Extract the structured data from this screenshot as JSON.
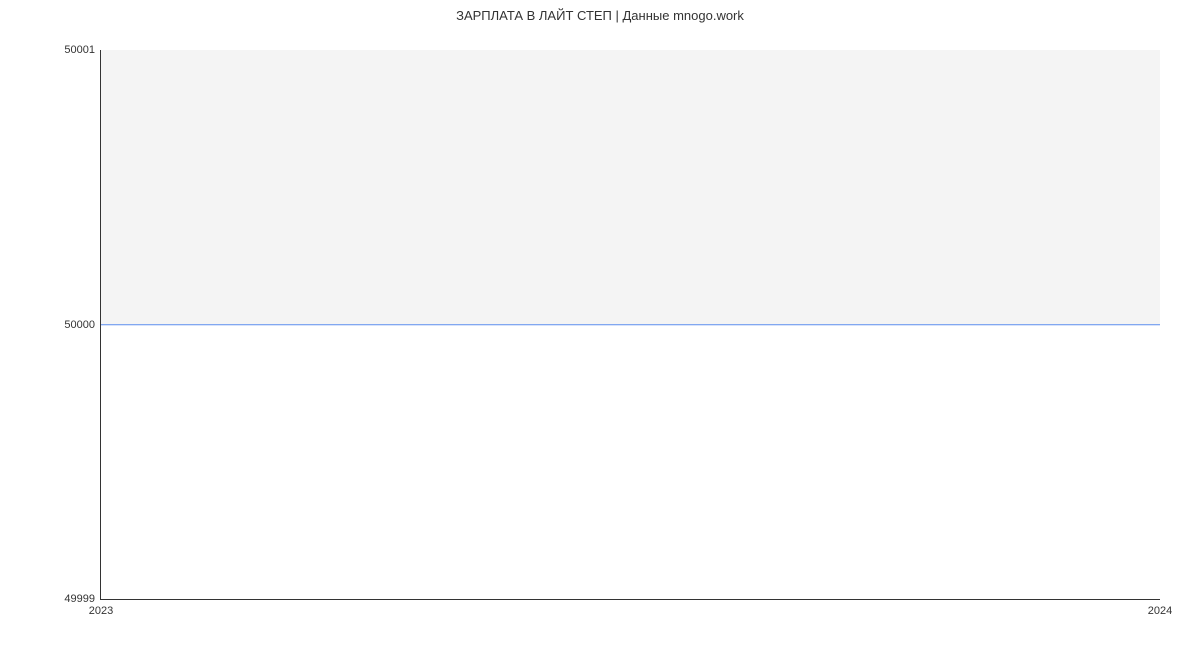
{
  "chart_data": {
    "type": "line",
    "title": "ЗАРПЛАТА В ЛАЙТ СТЕП | Данные mnogo.work",
    "xlabel": "",
    "ylabel": "",
    "x": [
      "2023",
      "2024"
    ],
    "values": [
      50000,
      50000
    ],
    "ylim": [
      49999,
      50001
    ],
    "y_ticks": [
      "49999",
      "50000",
      "50001"
    ],
    "x_ticks": [
      "2023",
      "2024"
    ],
    "line_color": "#5b8def"
  }
}
